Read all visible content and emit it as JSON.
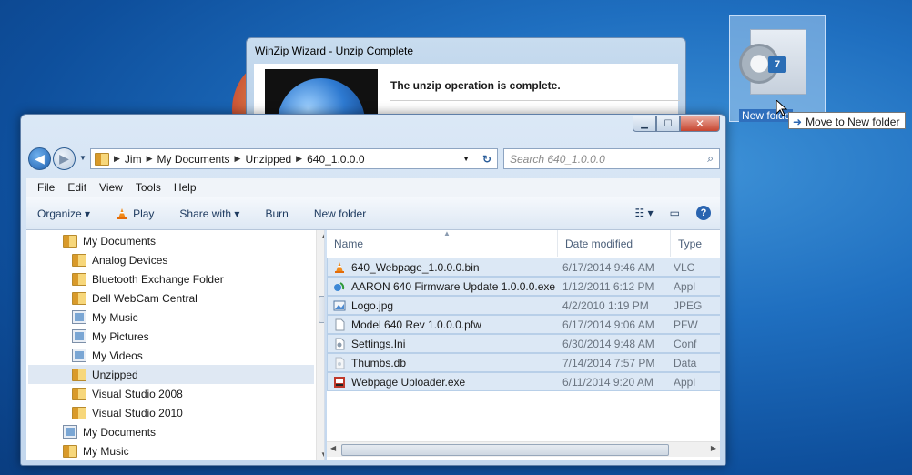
{
  "desktop": {
    "drag_folder_label": "New folde",
    "drag_badge": "7",
    "drop_tooltip": "Move to New folder"
  },
  "winzip": {
    "title": "WinZip Wizard - Unzip Complete",
    "message": "The unzip operation is complete."
  },
  "explorer": {
    "breadcrumb": [
      "Jim",
      "My Documents",
      "Unzipped",
      "640_1.0.0.0"
    ],
    "search_placeholder": "Search 640_1.0.0.0",
    "menu": [
      "File",
      "Edit",
      "View",
      "Tools",
      "Help"
    ],
    "toolbar": {
      "organize": "Organize ▾",
      "play": "Play",
      "share_with": "Share with ▾",
      "burn": "Burn",
      "new_folder": "New folder"
    },
    "tree": [
      {
        "label": "My Documents",
        "indent": 1,
        "icon": "folder"
      },
      {
        "label": "Analog Devices",
        "indent": 2,
        "icon": "folder"
      },
      {
        "label": "Bluetooth Exchange Folder",
        "indent": 2,
        "icon": "folder"
      },
      {
        "label": "Dell WebCam Central",
        "indent": 2,
        "icon": "folder"
      },
      {
        "label": "My Music",
        "indent": 2,
        "icon": "media"
      },
      {
        "label": "My Pictures",
        "indent": 2,
        "icon": "media"
      },
      {
        "label": "My Videos",
        "indent": 2,
        "icon": "media"
      },
      {
        "label": "Unzipped",
        "indent": 2,
        "icon": "folder",
        "selected": true
      },
      {
        "label": "Visual Studio 2008",
        "indent": 2,
        "icon": "folder"
      },
      {
        "label": "Visual Studio 2010",
        "indent": 2,
        "icon": "folder"
      },
      {
        "label": "My Documents",
        "indent": 1,
        "icon": "media"
      },
      {
        "label": "My Music",
        "indent": 1,
        "icon": "folder"
      }
    ],
    "columns": {
      "name": "Name",
      "date": "Date modified",
      "type": "Type"
    },
    "files": [
      {
        "name": "640_Webpage_1.0.0.0.bin",
        "date": "6/17/2014 9:46 AM",
        "type": "VLC",
        "icon": "vlc-cone-icon"
      },
      {
        "name": "AARON 640 Firmware Update 1.0.0.0.exe",
        "date": "1/12/2011 6:12 PM",
        "type": "Appl",
        "icon": "setup-exe-icon"
      },
      {
        "name": "Logo.jpg",
        "date": "4/2/2010 1:19 PM",
        "type": "JPEG",
        "icon": "image-file-icon"
      },
      {
        "name": "Model 640 Rev 1.0.0.0.pfw",
        "date": "6/17/2014 9:06 AM",
        "type": "PFW",
        "icon": "blank-file-icon"
      },
      {
        "name": "Settings.Ini",
        "date": "6/30/2014 9:48 AM",
        "type": "Conf",
        "icon": "settings-file-icon"
      },
      {
        "name": "Thumbs.db",
        "date": "7/14/2014 7:57 PM",
        "type": "Data",
        "icon": "db-file-icon"
      },
      {
        "name": "Webpage Uploader.exe",
        "date": "6/11/2014 9:20 AM",
        "type": "Appl",
        "icon": "uploader-exe-icon"
      }
    ]
  }
}
